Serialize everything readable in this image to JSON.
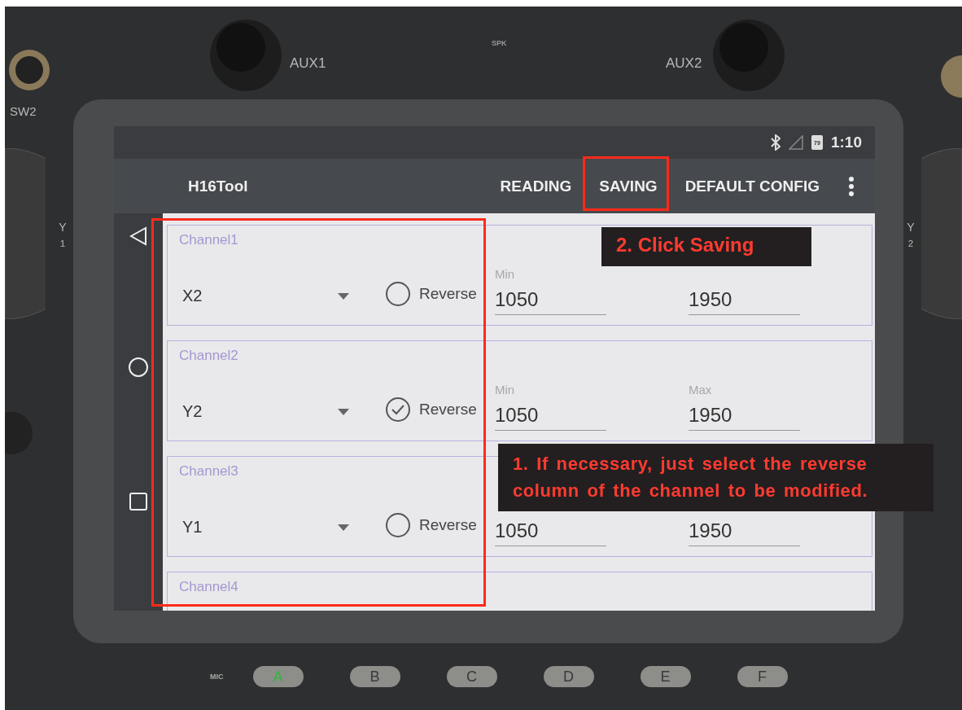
{
  "device": {
    "knobs": [
      {
        "label": "AUX1"
      },
      {
        "label": "AUX2"
      }
    ],
    "speaker_label": "SPK",
    "switch_label": "SW2",
    "stick_labels": [
      "Y$_{1}$",
      "Y$_{2}$"
    ],
    "mic_label": "MIC",
    "buttons": [
      {
        "label": "A",
        "lit": true
      },
      {
        "label": "B",
        "lit": false
      },
      {
        "label": "C",
        "lit": false
      },
      {
        "label": "D",
        "lit": false
      },
      {
        "label": "E",
        "lit": false
      },
      {
        "label": "F",
        "lit": false
      }
    ]
  },
  "status_bar": {
    "battery": "79",
    "time": "1:10"
  },
  "app_bar": {
    "title": "H16Tool",
    "actions": [
      {
        "label": "READING"
      },
      {
        "label": "SAVING"
      },
      {
        "label": "DEFAULT CONFIG"
      }
    ]
  },
  "channels": [
    {
      "title": "Channel1",
      "input": "X2",
      "reverse_label": "Reverse",
      "reverse": false,
      "min_label": "Min",
      "min": "1050",
      "max": "1950"
    },
    {
      "title": "Channel2",
      "input": "Y2",
      "reverse_label": "Reverse",
      "reverse": true,
      "min_label": "Min",
      "max_label": "Max",
      "min": "1050",
      "max": "1950"
    },
    {
      "title": "Channel3",
      "input": "Y1",
      "reverse_label": "Reverse",
      "reverse": false,
      "min": "1050",
      "max": "1950"
    },
    {
      "title": "Channel4"
    }
  ],
  "annotations": [
    {
      "kind": "saving",
      "text": "2. Click Saving"
    },
    {
      "kind": "reverse",
      "text": "1. If necessary, just select the reverse column of the channel to be modified."
    }
  ]
}
